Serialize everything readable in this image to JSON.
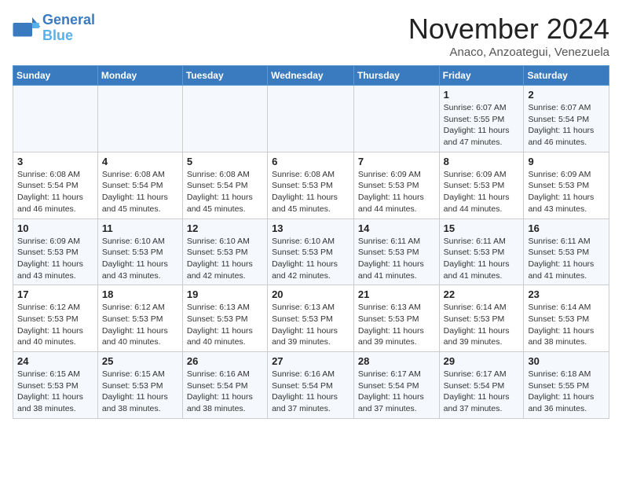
{
  "header": {
    "logo_line1": "General",
    "logo_line2": "Blue",
    "month": "November 2024",
    "location": "Anaco, Anzoategui, Venezuela"
  },
  "weekdays": [
    "Sunday",
    "Monday",
    "Tuesday",
    "Wednesday",
    "Thursday",
    "Friday",
    "Saturday"
  ],
  "weeks": [
    [
      {
        "day": "",
        "info": ""
      },
      {
        "day": "",
        "info": ""
      },
      {
        "day": "",
        "info": ""
      },
      {
        "day": "",
        "info": ""
      },
      {
        "day": "",
        "info": ""
      },
      {
        "day": "1",
        "info": "Sunrise: 6:07 AM\nSunset: 5:55 PM\nDaylight: 11 hours and 47 minutes."
      },
      {
        "day": "2",
        "info": "Sunrise: 6:07 AM\nSunset: 5:54 PM\nDaylight: 11 hours and 46 minutes."
      }
    ],
    [
      {
        "day": "3",
        "info": "Sunrise: 6:08 AM\nSunset: 5:54 PM\nDaylight: 11 hours and 46 minutes."
      },
      {
        "day": "4",
        "info": "Sunrise: 6:08 AM\nSunset: 5:54 PM\nDaylight: 11 hours and 45 minutes."
      },
      {
        "day": "5",
        "info": "Sunrise: 6:08 AM\nSunset: 5:54 PM\nDaylight: 11 hours and 45 minutes."
      },
      {
        "day": "6",
        "info": "Sunrise: 6:08 AM\nSunset: 5:53 PM\nDaylight: 11 hours and 45 minutes."
      },
      {
        "day": "7",
        "info": "Sunrise: 6:09 AM\nSunset: 5:53 PM\nDaylight: 11 hours and 44 minutes."
      },
      {
        "day": "8",
        "info": "Sunrise: 6:09 AM\nSunset: 5:53 PM\nDaylight: 11 hours and 44 minutes."
      },
      {
        "day": "9",
        "info": "Sunrise: 6:09 AM\nSunset: 5:53 PM\nDaylight: 11 hours and 43 minutes."
      }
    ],
    [
      {
        "day": "10",
        "info": "Sunrise: 6:09 AM\nSunset: 5:53 PM\nDaylight: 11 hours and 43 minutes."
      },
      {
        "day": "11",
        "info": "Sunrise: 6:10 AM\nSunset: 5:53 PM\nDaylight: 11 hours and 43 minutes."
      },
      {
        "day": "12",
        "info": "Sunrise: 6:10 AM\nSunset: 5:53 PM\nDaylight: 11 hours and 42 minutes."
      },
      {
        "day": "13",
        "info": "Sunrise: 6:10 AM\nSunset: 5:53 PM\nDaylight: 11 hours and 42 minutes."
      },
      {
        "day": "14",
        "info": "Sunrise: 6:11 AM\nSunset: 5:53 PM\nDaylight: 11 hours and 41 minutes."
      },
      {
        "day": "15",
        "info": "Sunrise: 6:11 AM\nSunset: 5:53 PM\nDaylight: 11 hours and 41 minutes."
      },
      {
        "day": "16",
        "info": "Sunrise: 6:11 AM\nSunset: 5:53 PM\nDaylight: 11 hours and 41 minutes."
      }
    ],
    [
      {
        "day": "17",
        "info": "Sunrise: 6:12 AM\nSunset: 5:53 PM\nDaylight: 11 hours and 40 minutes."
      },
      {
        "day": "18",
        "info": "Sunrise: 6:12 AM\nSunset: 5:53 PM\nDaylight: 11 hours and 40 minutes."
      },
      {
        "day": "19",
        "info": "Sunrise: 6:13 AM\nSunset: 5:53 PM\nDaylight: 11 hours and 40 minutes."
      },
      {
        "day": "20",
        "info": "Sunrise: 6:13 AM\nSunset: 5:53 PM\nDaylight: 11 hours and 39 minutes."
      },
      {
        "day": "21",
        "info": "Sunrise: 6:13 AM\nSunset: 5:53 PM\nDaylight: 11 hours and 39 minutes."
      },
      {
        "day": "22",
        "info": "Sunrise: 6:14 AM\nSunset: 5:53 PM\nDaylight: 11 hours and 39 minutes."
      },
      {
        "day": "23",
        "info": "Sunrise: 6:14 AM\nSunset: 5:53 PM\nDaylight: 11 hours and 38 minutes."
      }
    ],
    [
      {
        "day": "24",
        "info": "Sunrise: 6:15 AM\nSunset: 5:53 PM\nDaylight: 11 hours and 38 minutes."
      },
      {
        "day": "25",
        "info": "Sunrise: 6:15 AM\nSunset: 5:53 PM\nDaylight: 11 hours and 38 minutes."
      },
      {
        "day": "26",
        "info": "Sunrise: 6:16 AM\nSunset: 5:54 PM\nDaylight: 11 hours and 38 minutes."
      },
      {
        "day": "27",
        "info": "Sunrise: 6:16 AM\nSunset: 5:54 PM\nDaylight: 11 hours and 37 minutes."
      },
      {
        "day": "28",
        "info": "Sunrise: 6:17 AM\nSunset: 5:54 PM\nDaylight: 11 hours and 37 minutes."
      },
      {
        "day": "29",
        "info": "Sunrise: 6:17 AM\nSunset: 5:54 PM\nDaylight: 11 hours and 37 minutes."
      },
      {
        "day": "30",
        "info": "Sunrise: 6:18 AM\nSunset: 5:55 PM\nDaylight: 11 hours and 36 minutes."
      }
    ]
  ]
}
